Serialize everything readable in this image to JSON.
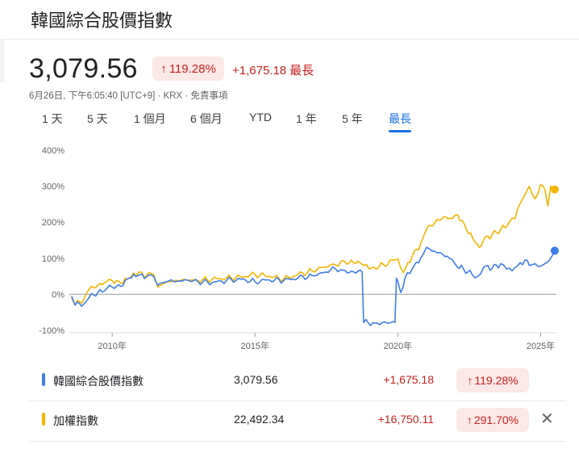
{
  "header": {
    "title": "韓國綜合股價指數"
  },
  "quote": {
    "price": "3,079.56",
    "pct_arrow": "↑",
    "pct": "119.28%",
    "change": "+1,675.18",
    "period_label": "最長",
    "meta": "6月26日, 下午6:05:40 [UTC+9] · KRX · 免責事項"
  },
  "tabs": [
    {
      "label": "1 天"
    },
    {
      "label": "5 天"
    },
    {
      "label": "1 個月"
    },
    {
      "label": "6 個月"
    },
    {
      "label": "YTD"
    },
    {
      "label": "1 年"
    },
    {
      "label": "5 年"
    },
    {
      "label": "最長",
      "active": true
    }
  ],
  "colors": {
    "kospi": "#3f7ee8",
    "taiex": "#f4b400",
    "negative": "#c5221f"
  },
  "chart_data": {
    "type": "line",
    "ytick_labels": [
      "400%",
      "300%",
      "200%",
      "100%",
      "0%",
      "-100%"
    ],
    "yticks": [
      400,
      300,
      200,
      100,
      0,
      -100
    ],
    "xtick_labels": [
      "2010年",
      "2015年",
      "2020年",
      "2025年"
    ],
    "xticks": [
      2010,
      2015,
      2020,
      2025
    ],
    "xlim": [
      2008.5,
      2025.55
    ],
    "ylim": [
      -100,
      400
    ],
    "grid": false,
    "series": [
      {
        "name": "韓國綜合股價指數",
        "color": "#3f7ee8",
        "x": [
          2008.58,
          2008.7,
          2008.85,
          2009.0,
          2009.2,
          2009.5,
          2009.8,
          2010.0,
          2010.3,
          2010.6,
          2010.9,
          2011.2,
          2011.45,
          2011.6,
          2011.75,
          2012.0,
          2012.3,
          2012.6,
          2013.0,
          2013.5,
          2014.0,
          2014.5,
          2015.0,
          2015.5,
          2016.0,
          2016.5,
          2017.0,
          2017.4,
          2017.8,
          2018.0,
          2018.3,
          2018.6,
          2018.75,
          2018.8,
          2019.2,
          2019.6,
          2019.9,
          2019.95,
          2020.0,
          2020.1,
          2020.25,
          2020.5,
          2020.8,
          2021.0,
          2021.2,
          2021.5,
          2021.8,
          2022.0,
          2022.3,
          2022.6,
          2022.8,
          2023.0,
          2023.3,
          2023.6,
          2023.8,
          2024.0,
          2024.2,
          2024.45,
          2024.6,
          2024.8,
          2025.0,
          2025.2,
          2025.35,
          2025.49
        ],
        "y": [
          -5,
          -30,
          -25,
          -28,
          -8,
          5,
          15,
          20,
          22,
          45,
          52,
          48,
          50,
          25,
          32,
          38,
          36,
          40,
          35,
          32,
          38,
          42,
          35,
          40,
          38,
          45,
          52,
          60,
          72,
          68,
          60,
          64,
          62,
          -78,
          -80,
          -79,
          -78,
          45,
          35,
          5,
          45,
          70,
          100,
          130,
          120,
          115,
          100,
          85,
          70,
          55,
          50,
          75,
          72,
          85,
          70,
          65,
          80,
          95,
          80,
          85,
          78,
          88,
          100,
          121
        ]
      },
      {
        "name": "加權指數",
        "color": "#f4b400",
        "x": [
          2008.58,
          2008.7,
          2008.85,
          2009.0,
          2009.2,
          2009.5,
          2009.8,
          2010.0,
          2010.3,
          2010.6,
          2010.9,
          2011.2,
          2011.45,
          2011.6,
          2011.75,
          2012.0,
          2012.3,
          2012.6,
          2013.0,
          2013.5,
          2014.0,
          2014.5,
          2015.0,
          2015.5,
          2016.0,
          2016.5,
          2017.0,
          2017.4,
          2017.8,
          2018.0,
          2018.3,
          2018.6,
          2018.8,
          2019.0,
          2019.5,
          2019.9,
          2020.0,
          2020.2,
          2020.5,
          2020.8,
          2021.0,
          2021.3,
          2021.6,
          2021.9,
          2022.1,
          2022.4,
          2022.7,
          2022.85,
          2023.0,
          2023.3,
          2023.6,
          2023.9,
          2024.1,
          2024.3,
          2024.5,
          2024.6,
          2024.8,
          2025.0,
          2025.15,
          2025.25,
          2025.35,
          2025.49
        ],
        "y": [
          -10,
          -30,
          -20,
          -15,
          15,
          25,
          35,
          38,
          30,
          45,
          58,
          52,
          55,
          20,
          28,
          35,
          38,
          40,
          38,
          42,
          45,
          48,
          55,
          50,
          42,
          55,
          65,
          75,
          82,
          90,
          88,
          92,
          80,
          70,
          82,
          95,
          98,
          60,
          105,
          140,
          180,
          200,
          215,
          210,
          220,
          180,
          145,
          130,
          150,
          165,
          180,
          200,
          210,
          255,
          285,
          300,
          265,
          305,
          290,
          245,
          300,
          291
        ]
      }
    ]
  },
  "legend": [
    {
      "name": "韓國綜合股價指數",
      "value": "3,079.56",
      "change": "+1,675.18",
      "pct_arrow": "↑",
      "pct": "119.28%",
      "color": "#3f7ee8"
    },
    {
      "name": "加權指數",
      "value": "22,492.34",
      "change": "+16,750.11",
      "pct_arrow": "↑",
      "pct": "291.70%",
      "color": "#f4b400",
      "close": "✕"
    }
  ]
}
